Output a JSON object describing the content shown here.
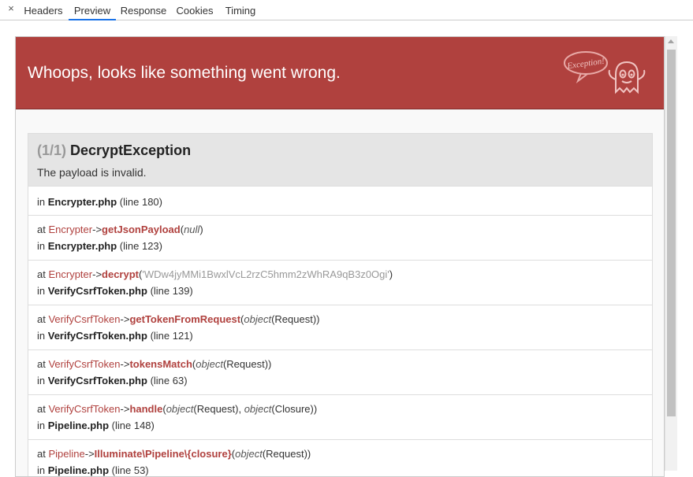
{
  "tabs": [
    {
      "label": "Headers",
      "active": false
    },
    {
      "label": "Preview",
      "active": true
    },
    {
      "label": "Response",
      "active": false
    },
    {
      "label": "Cookies",
      "active": false
    },
    {
      "label": "Timing",
      "active": false
    }
  ],
  "close_glyph": "×",
  "whoops": {
    "title": "Whoops, looks like something went wrong.",
    "bubble_text": "Exception!",
    "color": "#b0413e"
  },
  "exception": {
    "count": "(1/1)",
    "name": "DecryptException",
    "message": "The payload is invalid."
  },
  "trace": {
    "first": {
      "prefix": "in",
      "file": "Encrypter.php",
      "line": "(line 180)"
    },
    "frames": [
      {
        "prefix": "at",
        "class": "Encrypter",
        "arrow": "->",
        "method": "getJsonPayload",
        "args": [
          {
            "type": "null",
            "value": ""
          }
        ],
        "in": "in",
        "file": "Encrypter.php",
        "line": "(line 123)"
      },
      {
        "prefix": "at",
        "class": "Encrypter",
        "arrow": "->",
        "method": "decrypt",
        "args": [
          {
            "type": "",
            "value": "'WDw4jyMMi1BwxlVcL2rzC5hmm2zWhRA9qB3z0Ogi'"
          }
        ],
        "in": "in",
        "file": "VerifyCsrfToken.php",
        "line": "(line 139)"
      },
      {
        "prefix": "at",
        "class": "VerifyCsrfToken",
        "arrow": "->",
        "method": "getTokenFromRequest",
        "args": [
          {
            "type": "object",
            "value": "(Request)"
          }
        ],
        "in": "in",
        "file": "VerifyCsrfToken.php",
        "line": "(line 121)"
      },
      {
        "prefix": "at",
        "class": "VerifyCsrfToken",
        "arrow": "->",
        "method": "tokensMatch",
        "args": [
          {
            "type": "object",
            "value": "(Request)"
          }
        ],
        "in": "in",
        "file": "VerifyCsrfToken.php",
        "line": "(line 63)"
      },
      {
        "prefix": "at",
        "class": "VerifyCsrfToken",
        "arrow": "->",
        "method": "handle",
        "args": [
          {
            "type": "object",
            "value": "(Request)"
          },
          {
            "type": "object",
            "value": "(Closure)"
          }
        ],
        "in": "in",
        "file": "Pipeline.php",
        "line": "(line 148)"
      },
      {
        "prefix": "at",
        "class": "Pipeline",
        "arrow": "->",
        "method": "Illuminate\\Pipeline\\{closure}",
        "args": [
          {
            "type": "object",
            "value": "(Request)"
          }
        ],
        "in": "in",
        "file": "Pipeline.php",
        "line": "(line 53)"
      }
    ]
  }
}
